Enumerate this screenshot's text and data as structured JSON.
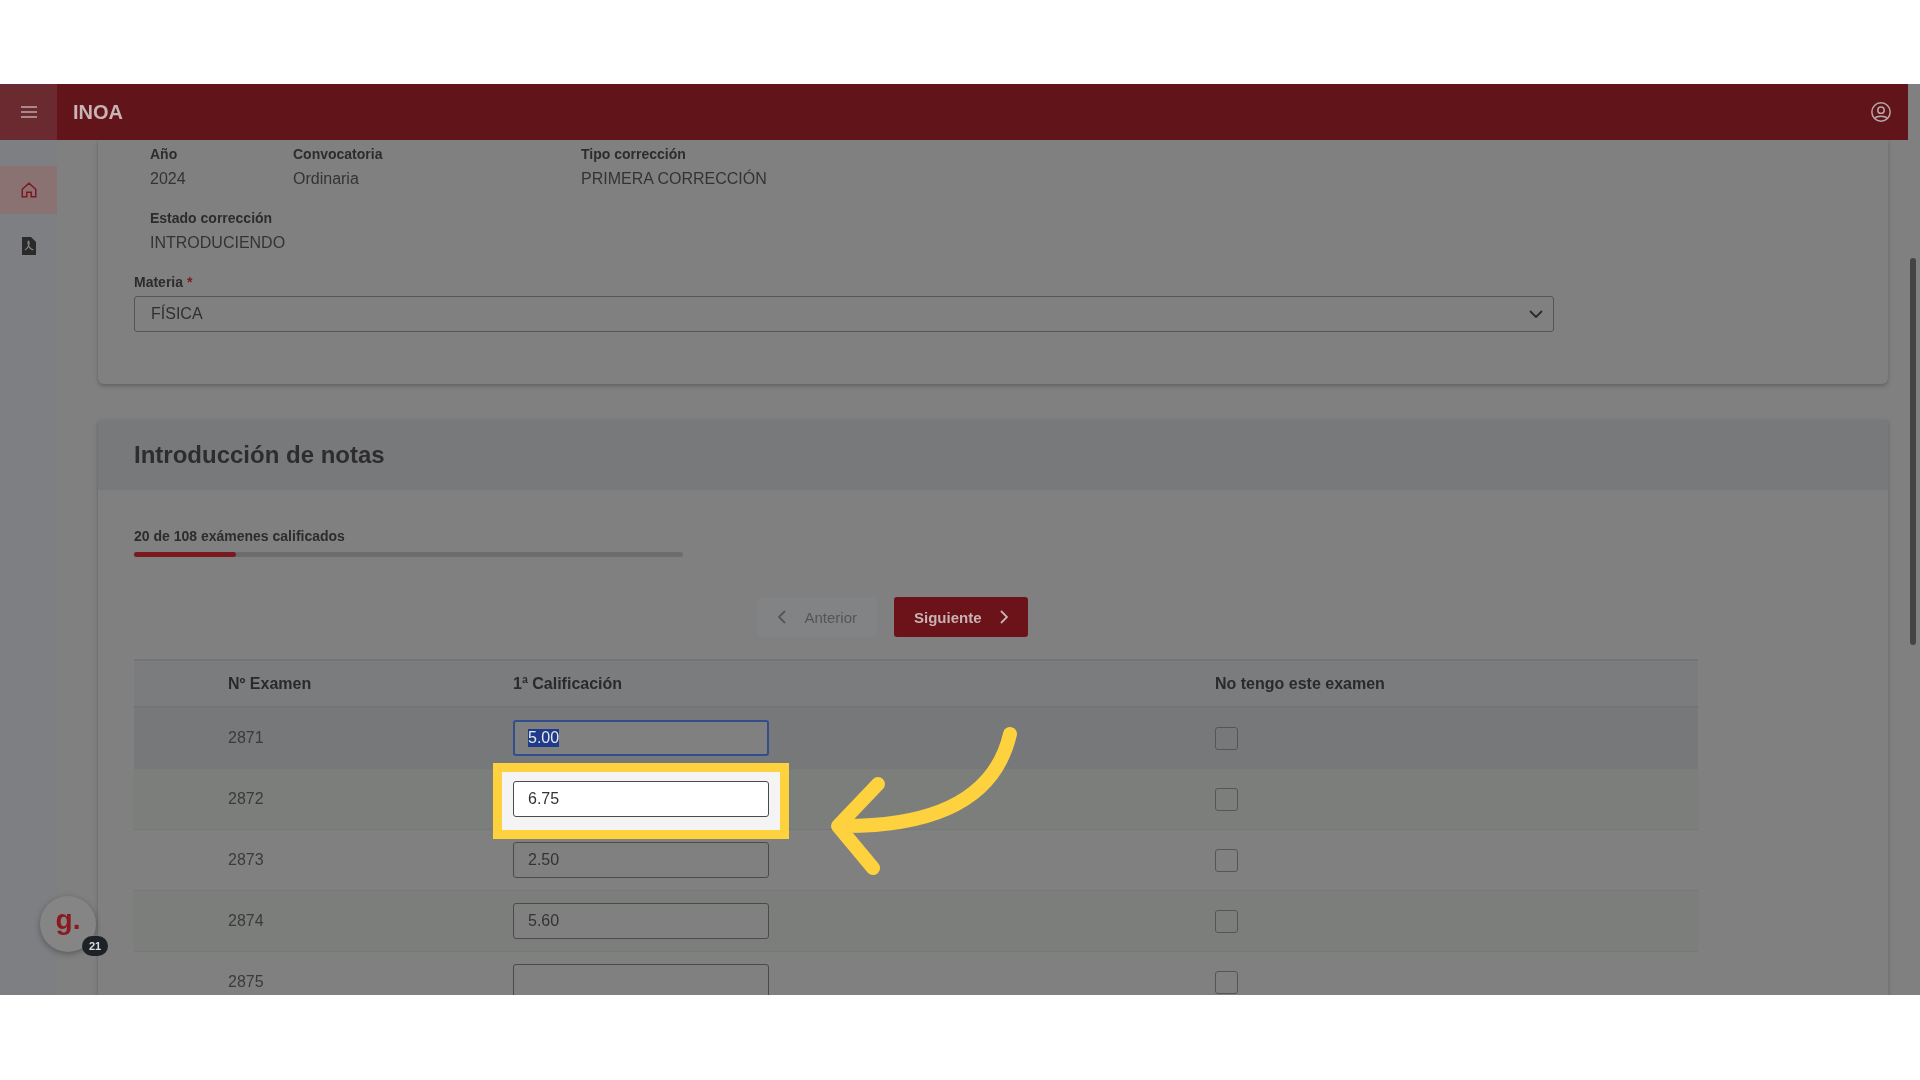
{
  "header": {
    "title": "INOA"
  },
  "sidebar": {
    "items": [
      {
        "kind": "home",
        "selected": true
      },
      {
        "kind": "pdf",
        "selected": false
      }
    ]
  },
  "details": [
    {
      "label": "Año",
      "value": "2024"
    },
    {
      "label": "Convocatoria",
      "value": "Ordinaria"
    },
    {
      "label": "Tipo corrección",
      "value": "PRIMERA CORRECCIÓN"
    },
    {
      "label": "Estado corrección",
      "value": "INTRODUCIENDO"
    }
  ],
  "subject": {
    "label": "Materia",
    "required_mark": "*",
    "value": "FÍSICA"
  },
  "grades": {
    "title": "Introducción de notas",
    "progress_text": "20 de 108 exámenes calificados",
    "level": 0.185,
    "buttons": [
      {
        "label": "Anterior",
        "kind": "previous",
        "disabled": true
      },
      {
        "label": "Siguiente",
        "kind": "next",
        "disabled": false
      }
    ],
    "columns": [
      "Nº Examen",
      "1ª Calificación",
      "No tengo este examen"
    ],
    "rows": [
      {
        "number": "2871",
        "grade": "5.00",
        "focused": true,
        "highlighted": false,
        "checked": false
      },
      {
        "number": "2872",
        "grade": "6.75",
        "focused": false,
        "highlighted": true,
        "checked": false
      },
      {
        "number": "2873",
        "grade": "2.50",
        "focused": false,
        "highlighted": false,
        "checked": false
      },
      {
        "number": "2874",
        "grade": "5.60",
        "focused": false,
        "highlighted": false,
        "checked": false
      },
      {
        "number": "2875",
        "focused": false,
        "highlighted": false,
        "checked": false
      }
    ]
  },
  "widget": {
    "logo": "g.",
    "count": "21"
  }
}
